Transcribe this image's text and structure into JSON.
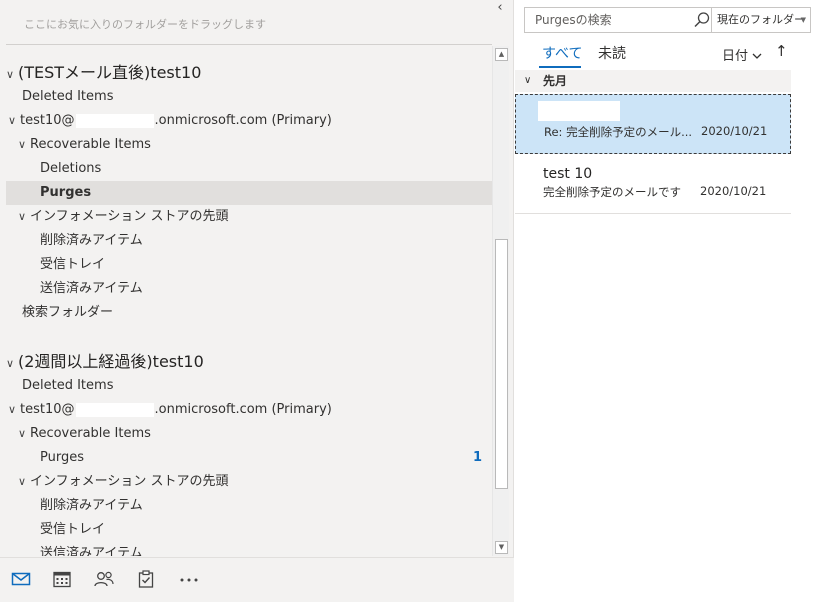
{
  "folder_pane": {
    "favorites_hint": "ここにお気に入りのフォルダーをドラッグします",
    "collapse_glyph": "‹",
    "accounts": [
      {
        "header": "(TESTメール直後)test10",
        "deleted_items": "Deleted Items",
        "mailbox_prefix": "test10@",
        "mailbox_suffix": ".onmicrosoft.com (Primary)",
        "recoverable_items": "Recoverable Items",
        "deletions": "Deletions",
        "purges": "Purges",
        "store_top": "インフォメーション ストアの先頭",
        "deleted_jp": "削除済みアイテム",
        "inbox_jp": "受信トレイ",
        "sent_jp": "送信済みアイテム",
        "search_folders": "検索フォルダー"
      },
      {
        "header": "(2週間以上経過後)test10",
        "deleted_items": "Deleted Items",
        "mailbox_prefix": "test10@",
        "mailbox_suffix": ".onmicrosoft.com (Primary)",
        "recoverable_items": "Recoverable Items",
        "purges": "Purges",
        "purges_count": "1",
        "store_top": "インフォメーション ストアの先頭",
        "deleted_jp": "削除済みアイテム",
        "inbox_jp": "受信トレイ",
        "sent_jp": "送信済みアイテム"
      }
    ],
    "selected_folder": "Purges"
  },
  "module_bar": {
    "items": [
      "mail-icon",
      "calendar-icon",
      "people-icon",
      "tasks-icon",
      "more-icon"
    ],
    "active": "mail-icon",
    "accent_color": "#0f6cbd"
  },
  "message_list": {
    "search_placeholder": "Purgesの検索",
    "scope": "現在のフォルダー",
    "tabs": {
      "all": "すべて",
      "unread": "未読"
    },
    "sort_label": "日付",
    "sort_glyph": "↑",
    "group_label": "先月",
    "messages": [
      {
        "sender": "",
        "subject": "Re: 完全削除予定のメール...",
        "date": "2020/10/21",
        "selected": true
      },
      {
        "sender": "test 10",
        "subject": "完全削除予定のメールです",
        "date": "2020/10/21",
        "selected": false
      }
    ]
  }
}
